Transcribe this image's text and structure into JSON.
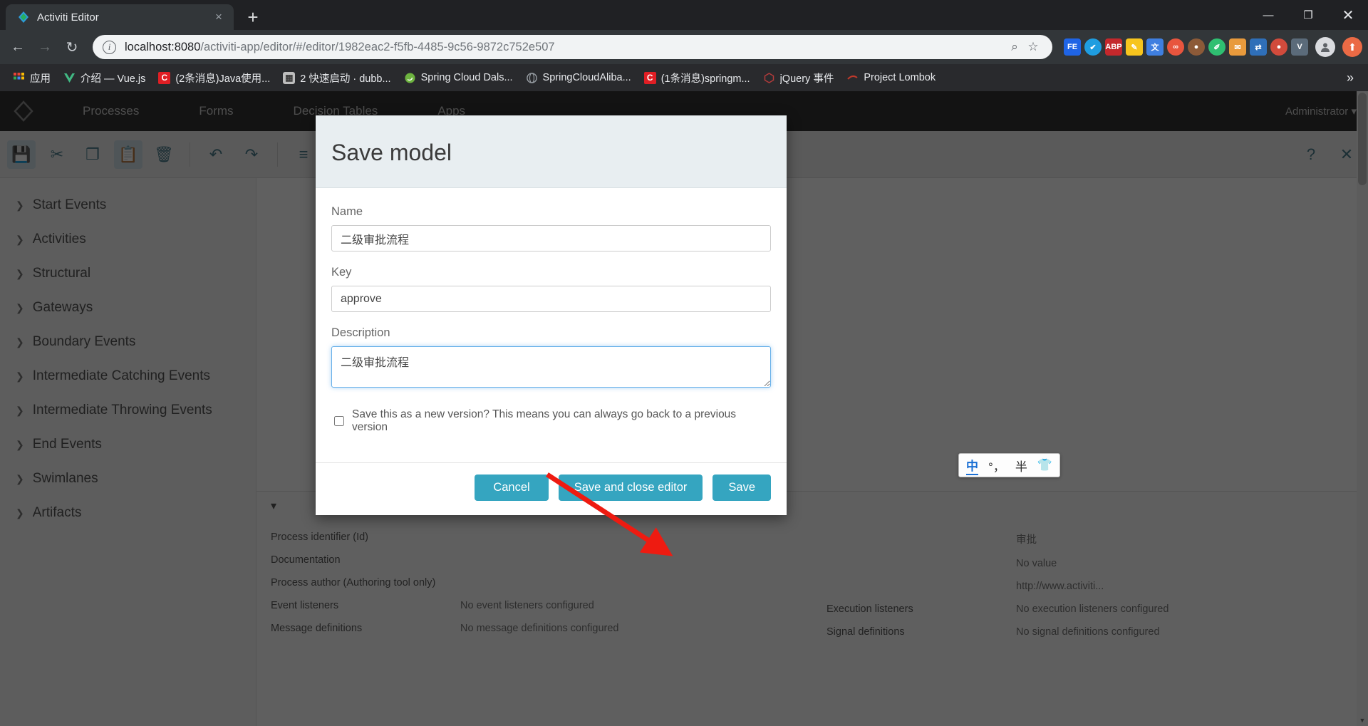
{
  "browser": {
    "tab": {
      "title": "Activiti Editor",
      "favicon": "activiti-diamond-icon",
      "close_label": "×"
    },
    "newtab_label": "+",
    "window_controls": {
      "minimize": "—",
      "maximize": "❐",
      "close": "✕"
    },
    "nav": {
      "back": "←",
      "forward": "→",
      "reload": "↻"
    },
    "omnibox": {
      "info_icon": "i",
      "url_host": "localhost:8080",
      "url_path": "/activiti-app/editor/#/editor/1982eac2-f5fb-4485-9c56-9872c752e507",
      "search_icon": "⌕",
      "bookmark_icon": "☆"
    },
    "extensions": [
      {
        "name": "feishu-extension",
        "glyph": "FE",
        "color": "#1f64e5"
      },
      {
        "name": "check-circle-extension",
        "glyph": "✔",
        "color": "#1f9de0",
        "round": true
      },
      {
        "name": "adblock-plus-extension",
        "glyph": "ABP",
        "color": "#c4282c"
      },
      {
        "name": "notes-extension",
        "glyph": "✎",
        "color": "#f7c51e"
      },
      {
        "name": "google-translate-extension",
        "glyph": "文",
        "color": "#3f7fe0"
      },
      {
        "name": "infinity-extension",
        "glyph": "∞",
        "color": "#e8553e",
        "round": true
      },
      {
        "name": "monkey-extension",
        "glyph": "●",
        "color": "#8c5a38",
        "round": true
      },
      {
        "name": "leaf-extension",
        "glyph": "✐",
        "color": "#2fbf71",
        "round": true
      },
      {
        "name": "clip-extension",
        "glyph": "✉",
        "color": "#e89a3c"
      },
      {
        "name": "sync-extension",
        "glyph": "⇄",
        "color": "#2f6fb8"
      },
      {
        "name": "bear-extension",
        "glyph": "●",
        "color": "#d14b3c",
        "round": true
      },
      {
        "name": "vimium-extension",
        "glyph": "V",
        "color": "#5b6b7a"
      }
    ],
    "avatar_label": "●",
    "menu_label": "⬆",
    "bookmarks": [
      {
        "label": "应用",
        "icon": "apps-grid-icon",
        "color": "#4285f4"
      },
      {
        "label": "介绍 — Vue.js",
        "icon": "vue-icon",
        "color": "#41b883"
      },
      {
        "label": "(2条消息)Java使用...",
        "icon": "csdn-icon",
        "color": "#e01e24"
      },
      {
        "label": "2 快速启动 · dubb...",
        "icon": "dubbo-icon",
        "color": "#bdbdbd"
      },
      {
        "label": "Spring Cloud Dals...",
        "icon": "spring-icon",
        "color": "#6db33f"
      },
      {
        "label": "SpringCloudAliba...",
        "icon": "globe-icon",
        "color": "#2b2b2b"
      },
      {
        "label": "(1条消息)springm...",
        "icon": "csdn-icon",
        "color": "#e01e24"
      },
      {
        "label": "jQuery 事件",
        "icon": "jquery-icon",
        "color": "#b23b3b"
      },
      {
        "label": "Project Lombok",
        "icon": "lombok-icon",
        "color": "#c0392b"
      }
    ],
    "bookmarks_overflow": "»"
  },
  "activiti": {
    "nav_items": [
      "Processes",
      "Forms",
      "Decision Tables",
      "Apps"
    ],
    "user_label": "Administrator",
    "user_caret": "▾",
    "toolbar_icons": [
      {
        "name": "save-icon",
        "glyph": "💾",
        "active": true
      },
      {
        "name": "cut-icon",
        "glyph": "✂"
      },
      {
        "name": "copy-icon",
        "glyph": "❐"
      },
      {
        "name": "paste-icon",
        "glyph": "📋",
        "active": true
      },
      {
        "name": "delete-icon",
        "glyph": "🗑"
      },
      {
        "name": "undo-icon",
        "glyph": "↶"
      },
      {
        "name": "redo-icon",
        "glyph": "↷"
      },
      {
        "name": "align-icon",
        "glyph": "≡"
      },
      {
        "name": "zoom-icon",
        "glyph": "⌕"
      },
      {
        "name": "fullscreen-icon",
        "glyph": "⛶"
      }
    ],
    "toolbar_right_icons": [
      {
        "name": "help-icon",
        "glyph": "?"
      },
      {
        "name": "close-editor-icon",
        "glyph": "✕"
      }
    ],
    "palette_items": [
      "Start Events",
      "Activities",
      "Structural",
      "Gateways",
      "Boundary Events",
      "Intermediate Catching Events",
      "Intermediate Throwing Events",
      "End Events",
      "Swimlanes",
      "Artifacts"
    ],
    "palette_caret": "❯",
    "properties": {
      "header_caret": "▾",
      "header_label": "",
      "left_rows": [
        {
          "key": "Process identifier (Id)",
          "value": ""
        },
        {
          "key": "Documentation",
          "value": ""
        },
        {
          "key": "Process author (Authoring tool only)",
          "value": ""
        },
        {
          "key": "Event listeners",
          "value": "No event listeners configured"
        },
        {
          "key": "Message definitions",
          "value": "No message definitions configured"
        }
      ],
      "right_rows": [
        {
          "key": "",
          "value": "审批"
        },
        {
          "key": "",
          "value": "No value"
        },
        {
          "key": "",
          "value": "http://www.activiti..."
        },
        {
          "key": "Execution listeners",
          "value": "No execution listeners configured"
        },
        {
          "key": "Signal definitions",
          "value": "No signal definitions configured"
        }
      ]
    },
    "scroll_up_arrow": "▲",
    "scroll_down_arrow": "▼"
  },
  "modal": {
    "title": "Save model",
    "fields": {
      "name": {
        "label": "Name",
        "value": "二级审批流程"
      },
      "key": {
        "label": "Key",
        "value": "approve"
      },
      "description": {
        "label": "Description",
        "value": "二级审批流程"
      }
    },
    "new_version_checkbox": {
      "label": "Save this as a new version? This means you can always go back to a previous version",
      "checked": false
    },
    "buttons": {
      "cancel": "Cancel",
      "save_and_close": "Save and close editor",
      "save": "Save"
    },
    "accent_color": "#35a5c0"
  },
  "annotation": {
    "arrow_color": "#ee1b11",
    "target": "save-and-close-editor-button"
  },
  "ime_bar": {
    "items": [
      {
        "name": "ime-chinese-mode",
        "glyph": "中",
        "highlight": true
      },
      {
        "name": "ime-punctuation-mode",
        "glyph": "°，"
      },
      {
        "name": "ime-halfwidth-mode",
        "glyph": "半"
      },
      {
        "name": "ime-skin-icon",
        "glyph": "👕"
      }
    ]
  }
}
